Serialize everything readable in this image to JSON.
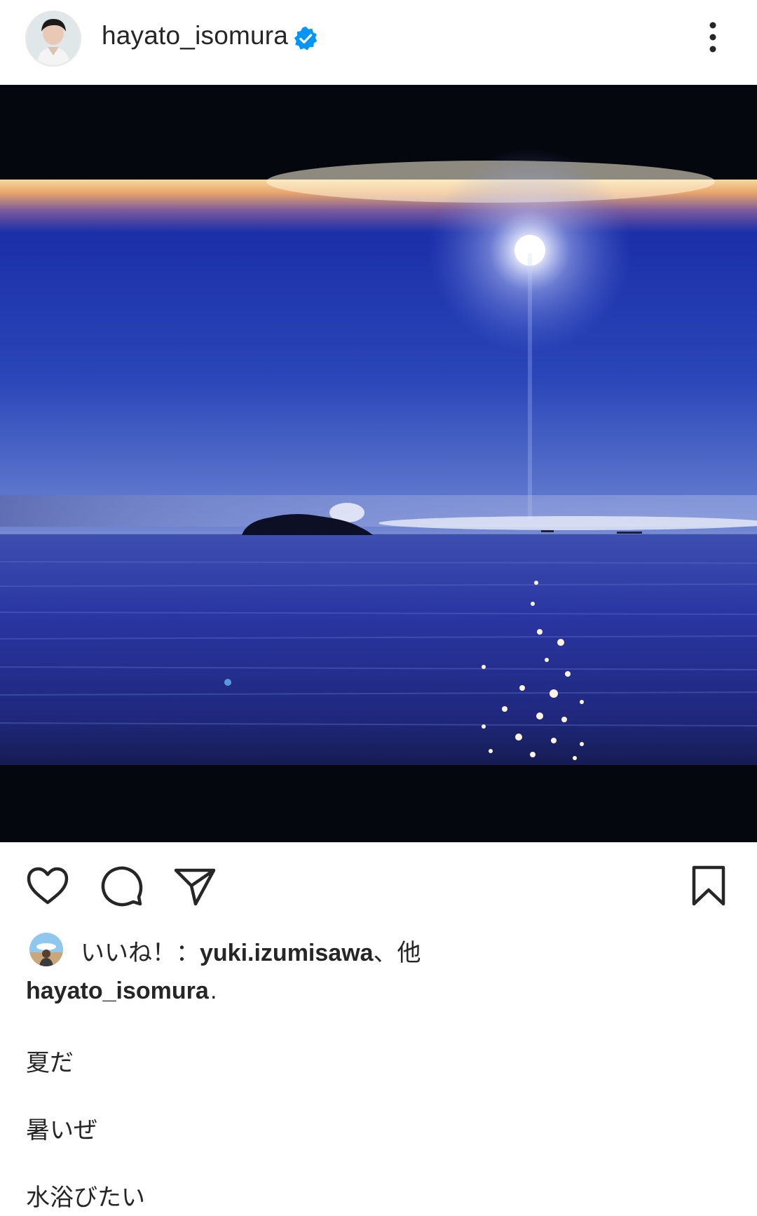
{
  "header": {
    "username": "hayato_isomura",
    "verified": true,
    "icons": {
      "verified": "verified-badge-icon",
      "more": "more-vertical-icon"
    }
  },
  "post": {
    "image_alt_icon": "photo",
    "actions": {
      "like": "heart-icon",
      "comment": "comment-icon",
      "share": "send-icon",
      "save": "bookmark-icon"
    },
    "likes": {
      "prefix": "いいね！：",
      "user": "yuki.izumisawa",
      "suffix": "、他"
    },
    "caption": {
      "username": "hayato_isomura",
      "first": ".",
      "lines": [
        "夏だ",
        "暑いぜ",
        "水浴びたい"
      ]
    }
  },
  "colors": {
    "verified_blue": "#0095f6",
    "text": "#262626"
  }
}
